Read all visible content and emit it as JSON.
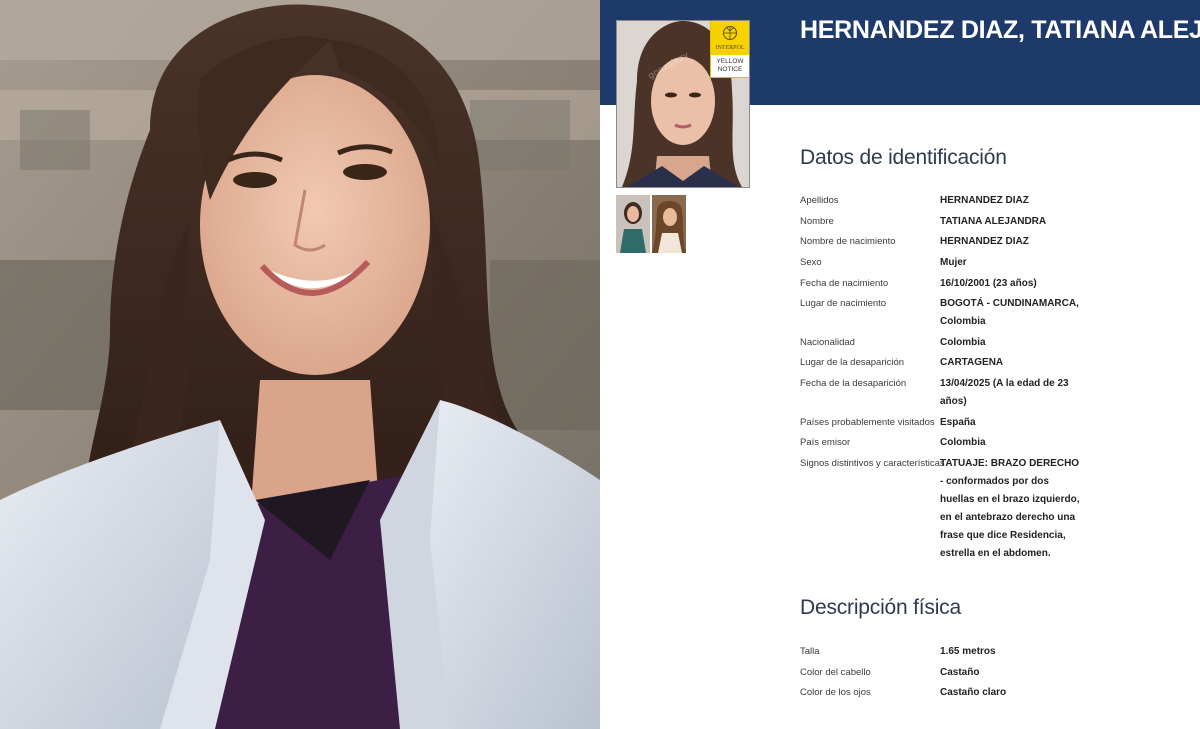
{
  "notice": {
    "person_name": "HERNANDEZ DIAZ, TATIANA ALEJANDRA",
    "badge": {
      "org": "INTERPOL",
      "type_line1": "YELLOW",
      "type_line2": "NOTICE",
      "color": "#f6d300"
    },
    "banner_color": "#1d3a6b",
    "identification": {
      "heading": "Datos de identificación",
      "fields": [
        {
          "label": "Apellidos",
          "value": "HERNANDEZ DIAZ"
        },
        {
          "label": "Nombre",
          "value": "TATIANA ALEJANDRA"
        },
        {
          "label": "Nombre de nacimiento",
          "value": "HERNANDEZ DIAZ"
        },
        {
          "label": "Sexo",
          "value": "Mujer"
        },
        {
          "label": "Fecha de nacimiento",
          "value": "16/10/2001 (23 años)"
        },
        {
          "label": "Lugar de nacimiento",
          "value": "BOGOTÁ - CUNDINAMARCA, Colombia"
        },
        {
          "label": "Nacionalidad",
          "value": "Colombia"
        },
        {
          "label": "Lugar de la desaparición",
          "value": "CARTAGENA"
        },
        {
          "label": "Fecha de la desaparición",
          "value": "13/04/2025 (A la edad de 23 años)"
        },
        {
          "label": "Países probablemente visitados",
          "value": "España"
        },
        {
          "label": "País emisor",
          "value": "Colombia"
        },
        {
          "label": "Signos distintivos y características",
          "value": "TATUAJE: BRAZO DERECHO - conformados por dos huellas en el brazo izquierdo, en el antebrazo derecho una frase que dice Residencia, estrella en el abdomen."
        }
      ]
    },
    "physical": {
      "heading": "Descripción física",
      "fields": [
        {
          "label": "Talla",
          "value": "1.65 metros"
        },
        {
          "label": "Color del cabello",
          "value": "Castaño"
        },
        {
          "label": "Color de los ojos",
          "value": "Castaño claro"
        }
      ]
    }
  },
  "icons": {
    "badge_emblem": "interpol-emblem-icon"
  }
}
